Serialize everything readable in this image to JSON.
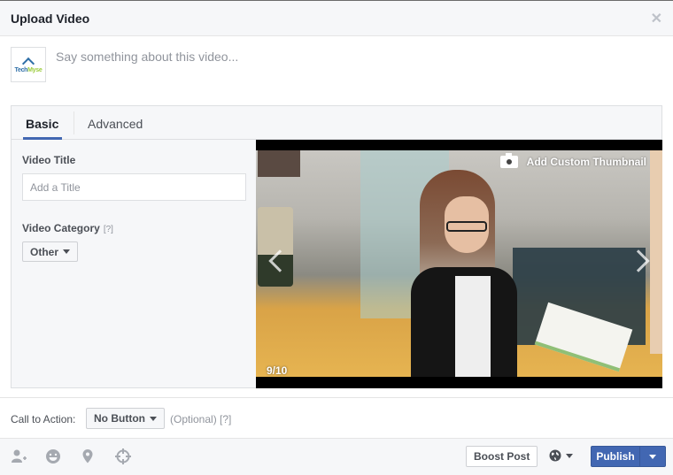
{
  "dialog": {
    "title": "Upload Video",
    "close_icon": "close-icon"
  },
  "composer": {
    "avatar_alt": "TechMyse",
    "avatar_text_a": "Tech",
    "avatar_text_b": "Myse",
    "placeholder": "Say something about this video..."
  },
  "tabs": [
    {
      "label": "Basic",
      "active": true
    },
    {
      "label": "Advanced",
      "active": false
    }
  ],
  "basic": {
    "video_title_label": "Video Title",
    "video_title_placeholder": "Add a Title",
    "video_title_value": "",
    "video_category_label": "Video Category",
    "help_marker": "[?]",
    "video_category_value": "Other"
  },
  "video": {
    "thumbnail_button": "Add Custom Thumbnail",
    "thumbnail_icon": "camera-icon",
    "counter": "9/10",
    "current_thumbnail": 9,
    "total_thumbnails": 10
  },
  "cta": {
    "label": "Call to Action:",
    "value": "No Button",
    "optional": "(Optional) [?]"
  },
  "footer": {
    "icons": [
      "tag-people-icon",
      "feeling-icon",
      "location-icon",
      "targeting-icon"
    ],
    "boost_label": "Boost Post",
    "audience_icon": "globe-icon",
    "publish_label": "Publish",
    "colors": {
      "primary": "#4267b2"
    }
  }
}
